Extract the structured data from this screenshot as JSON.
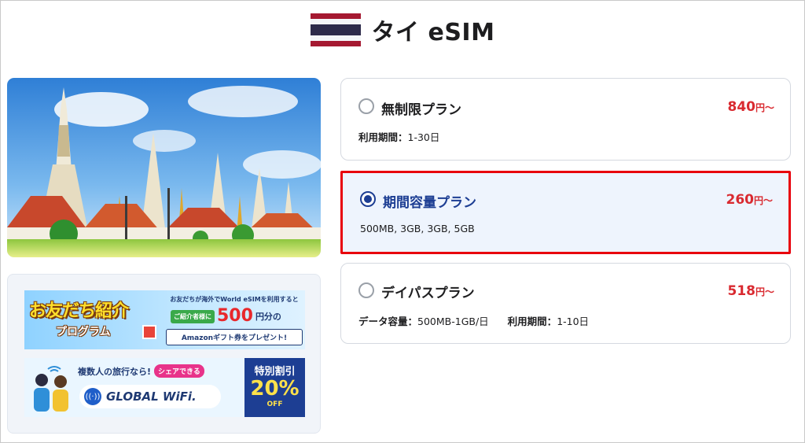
{
  "header": {
    "title": "タイ eSIM",
    "flag_colors": [
      "#a51931",
      "#f4f5f8",
      "#2d2a4a",
      "#2d2a4a",
      "#f4f5f8",
      "#a51931"
    ]
  },
  "hero": {
    "image": "wat-arun-temple-illustration"
  },
  "promos": {
    "referral": {
      "title": "お友だち紹介",
      "subtitle": "プログラム",
      "lead": "お友だちが海外でWorld eSIMを利用すると",
      "pill": "ご紹介者様に",
      "amount": "500",
      "unit": "円分の",
      "reward": "Amazonギフト券をプレゼント!"
    },
    "wifi": {
      "lead": "複数人の旅行なら!",
      "pill": "シェアできる",
      "logo": "GLOBAL WiFi.",
      "box_lead": "特別割引",
      "box_pct": "20%",
      "box_off": "OFF"
    }
  },
  "plans": [
    {
      "name": "無制限プラン",
      "price": "840",
      "price_unit": "円～",
      "selected": false,
      "detail_label1": "利用期間：",
      "detail_value1": "1-30日",
      "detail_label2": "",
      "detail_value2": ""
    },
    {
      "name": "期間容量プラン",
      "price": "260",
      "price_unit": "円～",
      "selected": true,
      "detail_label1": "",
      "detail_value1": "500MB, 3GB, 3GB, 5GB",
      "detail_label2": "",
      "detail_value2": ""
    },
    {
      "name": "デイパスプラン",
      "price": "518",
      "price_unit": "円～",
      "selected": false,
      "detail_label1": "データ容量：",
      "detail_value1": "500MB-1GB/日",
      "detail_label2": "利用期間：",
      "detail_value2": "1-10日"
    }
  ],
  "colors": {
    "accent_navy": "#1d3e93",
    "price_red": "#d92a30",
    "selected_border": "#e8000c",
    "selected_bg": "#eef4fd"
  }
}
